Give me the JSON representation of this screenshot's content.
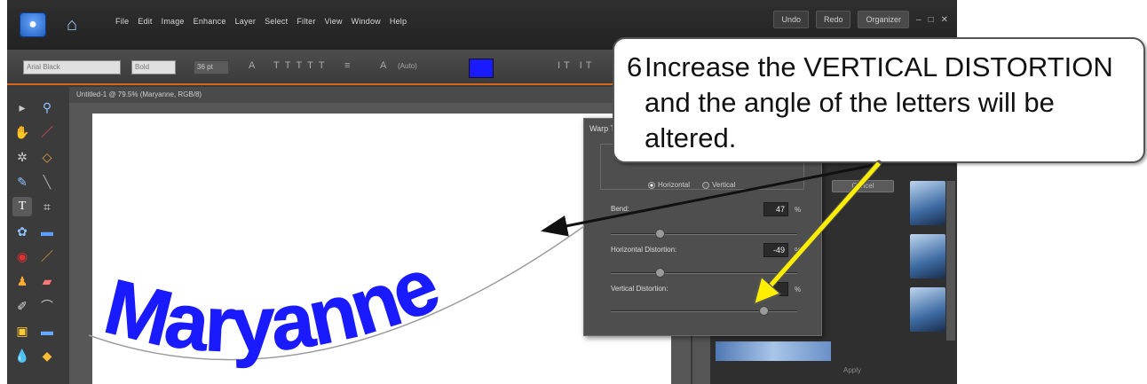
{
  "menu": {
    "items": [
      "File",
      "Edit",
      "Image",
      "Enhance",
      "Layer",
      "Select",
      "Filter",
      "View",
      "Window",
      "Help"
    ]
  },
  "topright": {
    "undo": "Undo",
    "redo": "Redo",
    "organizer": "Organizer"
  },
  "options": {
    "font_family": "Arial Black",
    "font_style": "Bold",
    "size": "36 pt",
    "leading": "(Auto)"
  },
  "document": {
    "title": "Untitled-1 @ 79.5% (Maryanne, RGB/8)"
  },
  "canvas_text": "Maryanne",
  "warp_dialog": {
    "title": "Warp Text",
    "horizontal_label": "Horizontal",
    "vertical_label": "Vertical",
    "bend_label": "Bend:",
    "bend_value": "47",
    "hdist_label": "Horizontal Distortion:",
    "hdist_value": "-49",
    "vdist_label": "Vertical Distortion:",
    "vdist_value": "",
    "bend_fraction": 0.26,
    "hdist_fraction": 0.26,
    "vdist_fraction": 0.82,
    "percent": "%"
  },
  "cancel_label": "Cancel",
  "panel_footer": "Apply",
  "callout": {
    "number": "6",
    "text": "Increase the VERTICAL DISTORTION and the angle of the letters will be altered."
  },
  "colors": {
    "text_color": "#1a1aff",
    "accent": "#d9661c",
    "arrow_yellow": "#ffee00"
  }
}
